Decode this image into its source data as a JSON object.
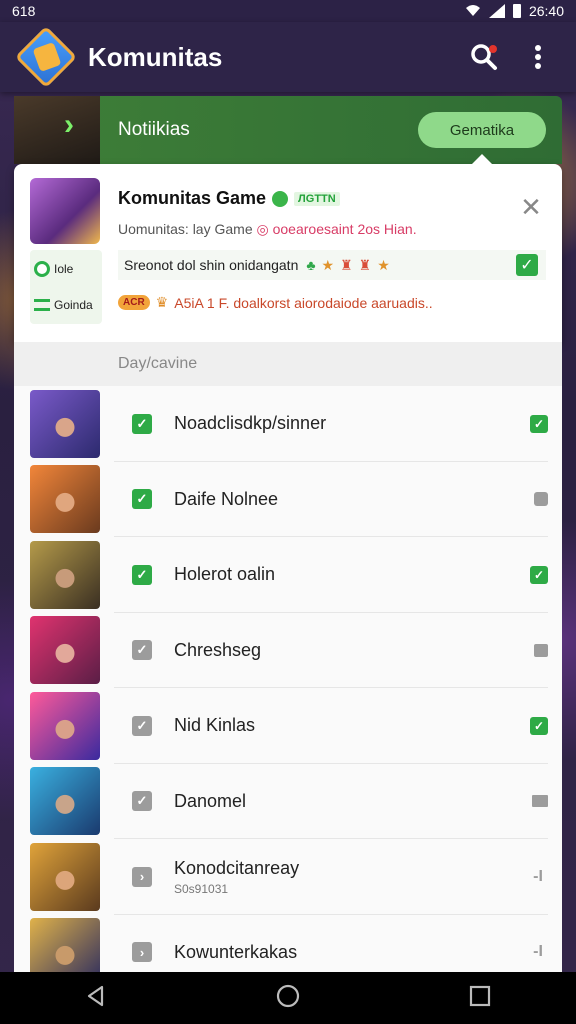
{
  "status_bar": {
    "time": "26:40",
    "left_text": "618"
  },
  "app_bar": {
    "title": "Komunitas"
  },
  "notification": {
    "label": "Notiikias",
    "button_label": "Gematika"
  },
  "popup": {
    "title": "Komunitas Game",
    "badge": "ЛGTTN",
    "subtitle_prefix": "Uomunitas:  lay Game",
    "subtitle_highlight": "◎ ooearoesaint  2os Hian.",
    "tag_1": "Iole",
    "tag_2": "Goinda",
    "line_1": "Sreonot dol shin onidangatn",
    "line_2_pill": "ACR",
    "line_2": "A5iA 1 F. doalkorst aiorodaiode aaruadis.."
  },
  "list": {
    "section_header": "Day/cavine",
    "items": [
      {
        "name": "Noadclisdkp/sinner",
        "sub": "",
        "checked": true,
        "right_icon": "check-icon"
      },
      {
        "name": "Daife Nolnee",
        "sub": "",
        "checked": true,
        "right_icon": "square-icon"
      },
      {
        "name": "Holerot oalin",
        "sub": "",
        "checked": true,
        "right_icon": "check-icon"
      },
      {
        "name": "Chreshseg",
        "sub": "",
        "checked": false,
        "right_icon": "chat-icon"
      },
      {
        "name": "Nid Kinlas",
        "sub": "",
        "checked": false,
        "right_icon": "check-icon"
      },
      {
        "name": "Danomel",
        "sub": "",
        "checked": false,
        "right_icon": "book-icon"
      },
      {
        "name": "Konodcitanreay",
        "sub": "S0s91031",
        "checked": false,
        "right_icon": "dash-icon"
      },
      {
        "name": "Kowunterkakas",
        "sub": "",
        "checked": false,
        "right_icon": "dash-icon"
      }
    ]
  },
  "colors": {
    "accent_green": "#2eaa46",
    "app_bar": "#2e2448",
    "notif_green": "#3f7f38"
  }
}
